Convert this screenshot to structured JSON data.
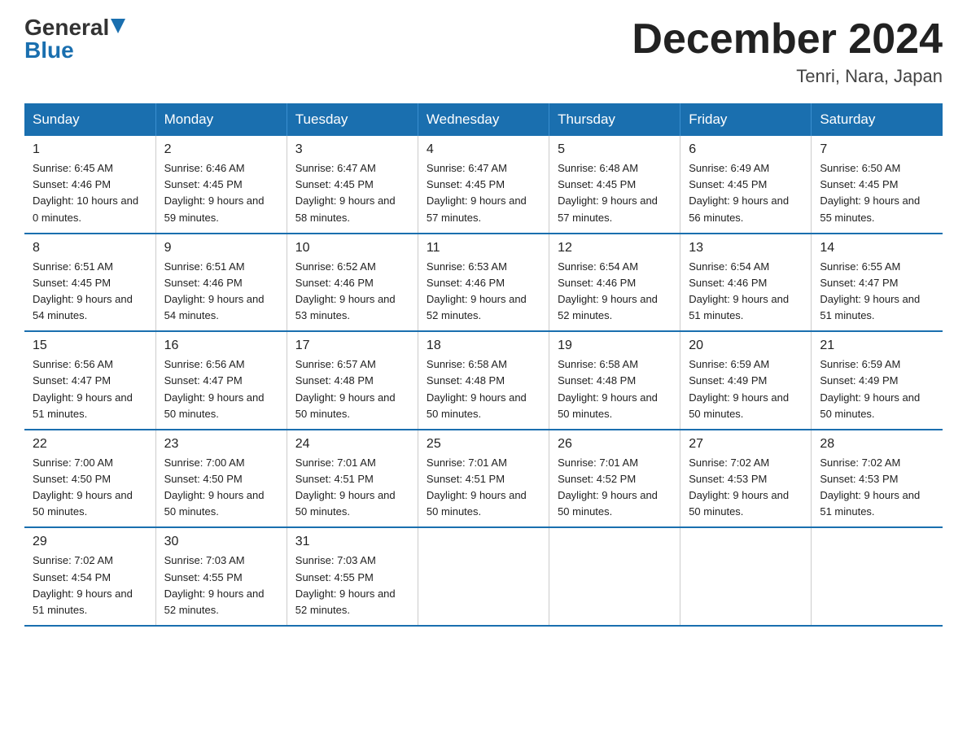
{
  "logo": {
    "general": "General",
    "blue": "Blue"
  },
  "title": "December 2024",
  "location": "Tenri, Nara, Japan",
  "days_of_week": [
    "Sunday",
    "Monday",
    "Tuesday",
    "Wednesday",
    "Thursday",
    "Friday",
    "Saturday"
  ],
  "weeks": [
    [
      {
        "day": "1",
        "sunrise": "6:45 AM",
        "sunset": "4:46 PM",
        "daylight": "10 hours and 0 minutes."
      },
      {
        "day": "2",
        "sunrise": "6:46 AM",
        "sunset": "4:45 PM",
        "daylight": "9 hours and 59 minutes."
      },
      {
        "day": "3",
        "sunrise": "6:47 AM",
        "sunset": "4:45 PM",
        "daylight": "9 hours and 58 minutes."
      },
      {
        "day": "4",
        "sunrise": "6:47 AM",
        "sunset": "4:45 PM",
        "daylight": "9 hours and 57 minutes."
      },
      {
        "day": "5",
        "sunrise": "6:48 AM",
        "sunset": "4:45 PM",
        "daylight": "9 hours and 57 minutes."
      },
      {
        "day": "6",
        "sunrise": "6:49 AM",
        "sunset": "4:45 PM",
        "daylight": "9 hours and 56 minutes."
      },
      {
        "day": "7",
        "sunrise": "6:50 AM",
        "sunset": "4:45 PM",
        "daylight": "9 hours and 55 minutes."
      }
    ],
    [
      {
        "day": "8",
        "sunrise": "6:51 AM",
        "sunset": "4:45 PM",
        "daylight": "9 hours and 54 minutes."
      },
      {
        "day": "9",
        "sunrise": "6:51 AM",
        "sunset": "4:46 PM",
        "daylight": "9 hours and 54 minutes."
      },
      {
        "day": "10",
        "sunrise": "6:52 AM",
        "sunset": "4:46 PM",
        "daylight": "9 hours and 53 minutes."
      },
      {
        "day": "11",
        "sunrise": "6:53 AM",
        "sunset": "4:46 PM",
        "daylight": "9 hours and 52 minutes."
      },
      {
        "day": "12",
        "sunrise": "6:54 AM",
        "sunset": "4:46 PM",
        "daylight": "9 hours and 52 minutes."
      },
      {
        "day": "13",
        "sunrise": "6:54 AM",
        "sunset": "4:46 PM",
        "daylight": "9 hours and 51 minutes."
      },
      {
        "day": "14",
        "sunrise": "6:55 AM",
        "sunset": "4:47 PM",
        "daylight": "9 hours and 51 minutes."
      }
    ],
    [
      {
        "day": "15",
        "sunrise": "6:56 AM",
        "sunset": "4:47 PM",
        "daylight": "9 hours and 51 minutes."
      },
      {
        "day": "16",
        "sunrise": "6:56 AM",
        "sunset": "4:47 PM",
        "daylight": "9 hours and 50 minutes."
      },
      {
        "day": "17",
        "sunrise": "6:57 AM",
        "sunset": "4:48 PM",
        "daylight": "9 hours and 50 minutes."
      },
      {
        "day": "18",
        "sunrise": "6:58 AM",
        "sunset": "4:48 PM",
        "daylight": "9 hours and 50 minutes."
      },
      {
        "day": "19",
        "sunrise": "6:58 AM",
        "sunset": "4:48 PM",
        "daylight": "9 hours and 50 minutes."
      },
      {
        "day": "20",
        "sunrise": "6:59 AM",
        "sunset": "4:49 PM",
        "daylight": "9 hours and 50 minutes."
      },
      {
        "day": "21",
        "sunrise": "6:59 AM",
        "sunset": "4:49 PM",
        "daylight": "9 hours and 50 minutes."
      }
    ],
    [
      {
        "day": "22",
        "sunrise": "7:00 AM",
        "sunset": "4:50 PM",
        "daylight": "9 hours and 50 minutes."
      },
      {
        "day": "23",
        "sunrise": "7:00 AM",
        "sunset": "4:50 PM",
        "daylight": "9 hours and 50 minutes."
      },
      {
        "day": "24",
        "sunrise": "7:01 AM",
        "sunset": "4:51 PM",
        "daylight": "9 hours and 50 minutes."
      },
      {
        "day": "25",
        "sunrise": "7:01 AM",
        "sunset": "4:51 PM",
        "daylight": "9 hours and 50 minutes."
      },
      {
        "day": "26",
        "sunrise": "7:01 AM",
        "sunset": "4:52 PM",
        "daylight": "9 hours and 50 minutes."
      },
      {
        "day": "27",
        "sunrise": "7:02 AM",
        "sunset": "4:53 PM",
        "daylight": "9 hours and 50 minutes."
      },
      {
        "day": "28",
        "sunrise": "7:02 AM",
        "sunset": "4:53 PM",
        "daylight": "9 hours and 51 minutes."
      }
    ],
    [
      {
        "day": "29",
        "sunrise": "7:02 AM",
        "sunset": "4:54 PM",
        "daylight": "9 hours and 51 minutes."
      },
      {
        "day": "30",
        "sunrise": "7:03 AM",
        "sunset": "4:55 PM",
        "daylight": "9 hours and 52 minutes."
      },
      {
        "day": "31",
        "sunrise": "7:03 AM",
        "sunset": "4:55 PM",
        "daylight": "9 hours and 52 minutes."
      },
      null,
      null,
      null,
      null
    ]
  ]
}
